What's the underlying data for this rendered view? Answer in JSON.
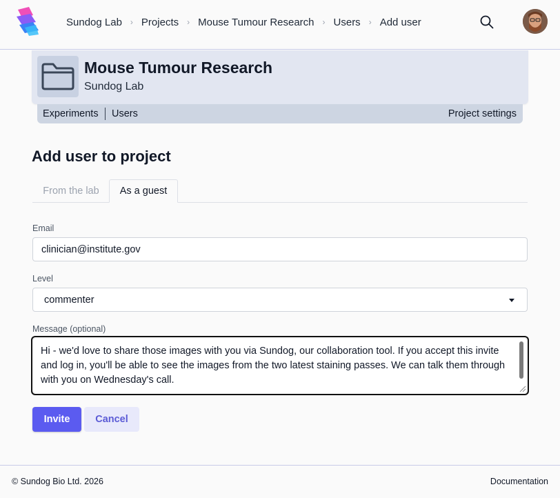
{
  "header": {
    "breadcrumbs": [
      "Sundog Lab",
      "Projects",
      "Mouse Tumour Research",
      "Users",
      "Add user"
    ],
    "separator": "›"
  },
  "project": {
    "title": "Mouse Tumour Research",
    "lab": "Sundog Lab",
    "nav": {
      "experiments": "Experiments",
      "users": "Users",
      "settings": "Project settings"
    }
  },
  "main": {
    "title": "Add user to project",
    "tabs": [
      {
        "label": "From the lab",
        "active": false
      },
      {
        "label": "As a guest",
        "active": true
      }
    ],
    "email": {
      "label": "Email",
      "value": "clinician@institute.gov"
    },
    "level": {
      "label": "Level",
      "value": "commenter"
    },
    "message": {
      "label": "Message (optional)",
      "value": "Hi - we'd love to share those images with you via Sundog, our collaboration tool. If you accept this invite and log in, you'll be able to see the images from the two latest staining passes. We can talk them through with you on Wednesday's call."
    },
    "invite_label": "Invite",
    "cancel_label": "Cancel"
  },
  "footer": {
    "copyright": "© Sundog Bio Ltd. 2026",
    "docs": "Documentation"
  },
  "colors": {
    "accent": "#5b5bf0",
    "project_header": "#e2e6f1",
    "project_nav": "#cdd5e2"
  },
  "icons": [
    "sundog-logo-icon",
    "search-icon",
    "folder-icon",
    "chevron-right-icon",
    "caret-down-icon"
  ]
}
